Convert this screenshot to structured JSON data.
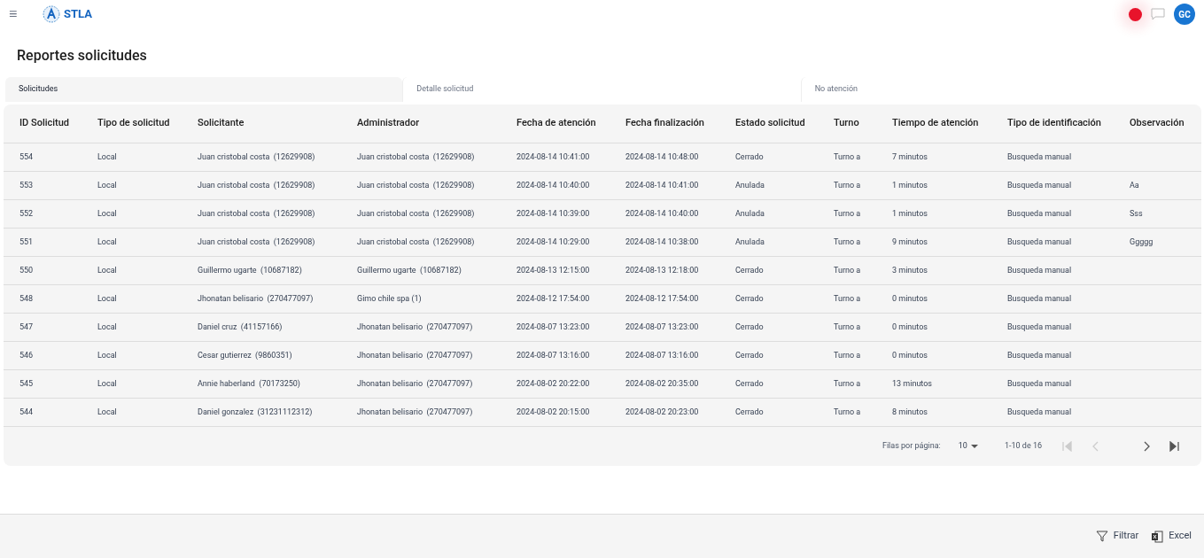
{
  "app_bar": {
    "menu_icon": "≡",
    "brand": "STLA",
    "avatar": "GC"
  },
  "page_title": "Reportes solicitudes",
  "tabs": [
    {
      "label": "Solicitudes",
      "selected": true
    },
    {
      "label": "Detalle solicitud",
      "selected": false
    },
    {
      "label": "No atención",
      "selected": false
    }
  ],
  "table": {
    "columns": [
      "ID Solicitud",
      "Tipo de solicitud",
      "Solicitante",
      "Administrador",
      "Fecha de atención",
      "Fecha finalización",
      "Estado solicitud",
      "Turno",
      "Tiempo de atención",
      "Tipo de identificación",
      "Observación"
    ],
    "rows": [
      [
        "554",
        "Local",
        "Juan cristobal costa  (12629908)",
        "Juan cristobal costa  (12629908)",
        "2024-08-14 10:41:00",
        "2024-08-14 10:48:00",
        "Cerrado",
        "Turno a",
        "7 minutos",
        "Busqueda manual",
        ""
      ],
      [
        "553",
        "Local",
        "Juan cristobal costa  (12629908)",
        "Juan cristobal costa  (12629908)",
        "2024-08-14 10:40:00",
        "2024-08-14 10:41:00",
        "Anulada",
        "Turno a",
        "1 minutos",
        "Busqueda manual",
        "Aa"
      ],
      [
        "552",
        "Local",
        "Juan cristobal costa  (12629908)",
        "Juan cristobal costa  (12629908)",
        "2024-08-14 10:39:00",
        "2024-08-14 10:40:00",
        "Anulada",
        "Turno a",
        "1 minutos",
        "Busqueda manual",
        "Sss"
      ],
      [
        "551",
        "Local",
        "Juan cristobal costa  (12629908)",
        "Juan cristobal costa  (12629908)",
        "2024-08-14 10:29:00",
        "2024-08-14 10:38:00",
        "Anulada",
        "Turno a",
        "9 minutos",
        "Busqueda manual",
        "Ggggg"
      ],
      [
        "550",
        "Local",
        "Guillermo ugarte  (10687182)",
        "Guillermo ugarte  (10687182)",
        "2024-08-13 12:15:00",
        "2024-08-13 12:18:00",
        "Cerrado",
        "Turno a",
        "3 minutos",
        "Busqueda manual",
        ""
      ],
      [
        "548",
        "Local",
        "Jhonatan belisario  (270477097)",
        "Gimo chile spa (1)",
        "2024-08-12 17:54:00",
        "2024-08-12 17:54:00",
        "Cerrado",
        "Turno a",
        "0 minutos",
        "Busqueda manual",
        ""
      ],
      [
        "547",
        "Local",
        "Daniel cruz  (41157166)",
        "Jhonatan belisario  (270477097)",
        "2024-08-07 13:23:00",
        "2024-08-07 13:23:00",
        "Cerrado",
        "Turno a",
        "0 minutos",
        "Busqueda manual",
        ""
      ],
      [
        "546",
        "Local",
        "Cesar gutierrez  (9860351)",
        "Jhonatan belisario  (270477097)",
        "2024-08-07 13:16:00",
        "2024-08-07 13:16:00",
        "Cerrado",
        "Turno a",
        "0 minutos",
        "Busqueda manual",
        ""
      ],
      [
        "545",
        "Local",
        "Annie haberland  (70173250)",
        "Jhonatan belisario  (270477097)",
        "2024-08-02 20:22:00",
        "2024-08-02 20:35:00",
        "Cerrado",
        "Turno a",
        "13 minutos",
        "Busqueda manual",
        ""
      ],
      [
        "544",
        "Local",
        "Daniel gonzalez  (31231112312)",
        "Jhonatan belisario  (270477097)",
        "2024-08-02 20:15:00",
        "2024-08-02 20:23:00",
        "Cerrado",
        "Turno a",
        "8 minutos",
        "Busqueda manual",
        ""
      ]
    ]
  },
  "pagination": {
    "rows_per_page_label": "Filas por página:",
    "rows_per_page": "10",
    "range": "1-10 de 16",
    "buttons": [
      {
        "kind": "first",
        "disabled": true
      },
      {
        "kind": "prev",
        "disabled": true
      },
      {
        "kind": "next",
        "disabled": false
      },
      {
        "kind": "last",
        "disabled": false
      }
    ]
  },
  "footer_actions": [
    {
      "kind": "filter",
      "label": "Filtrar"
    },
    {
      "kind": "excel",
      "label": "Excel"
    }
  ]
}
